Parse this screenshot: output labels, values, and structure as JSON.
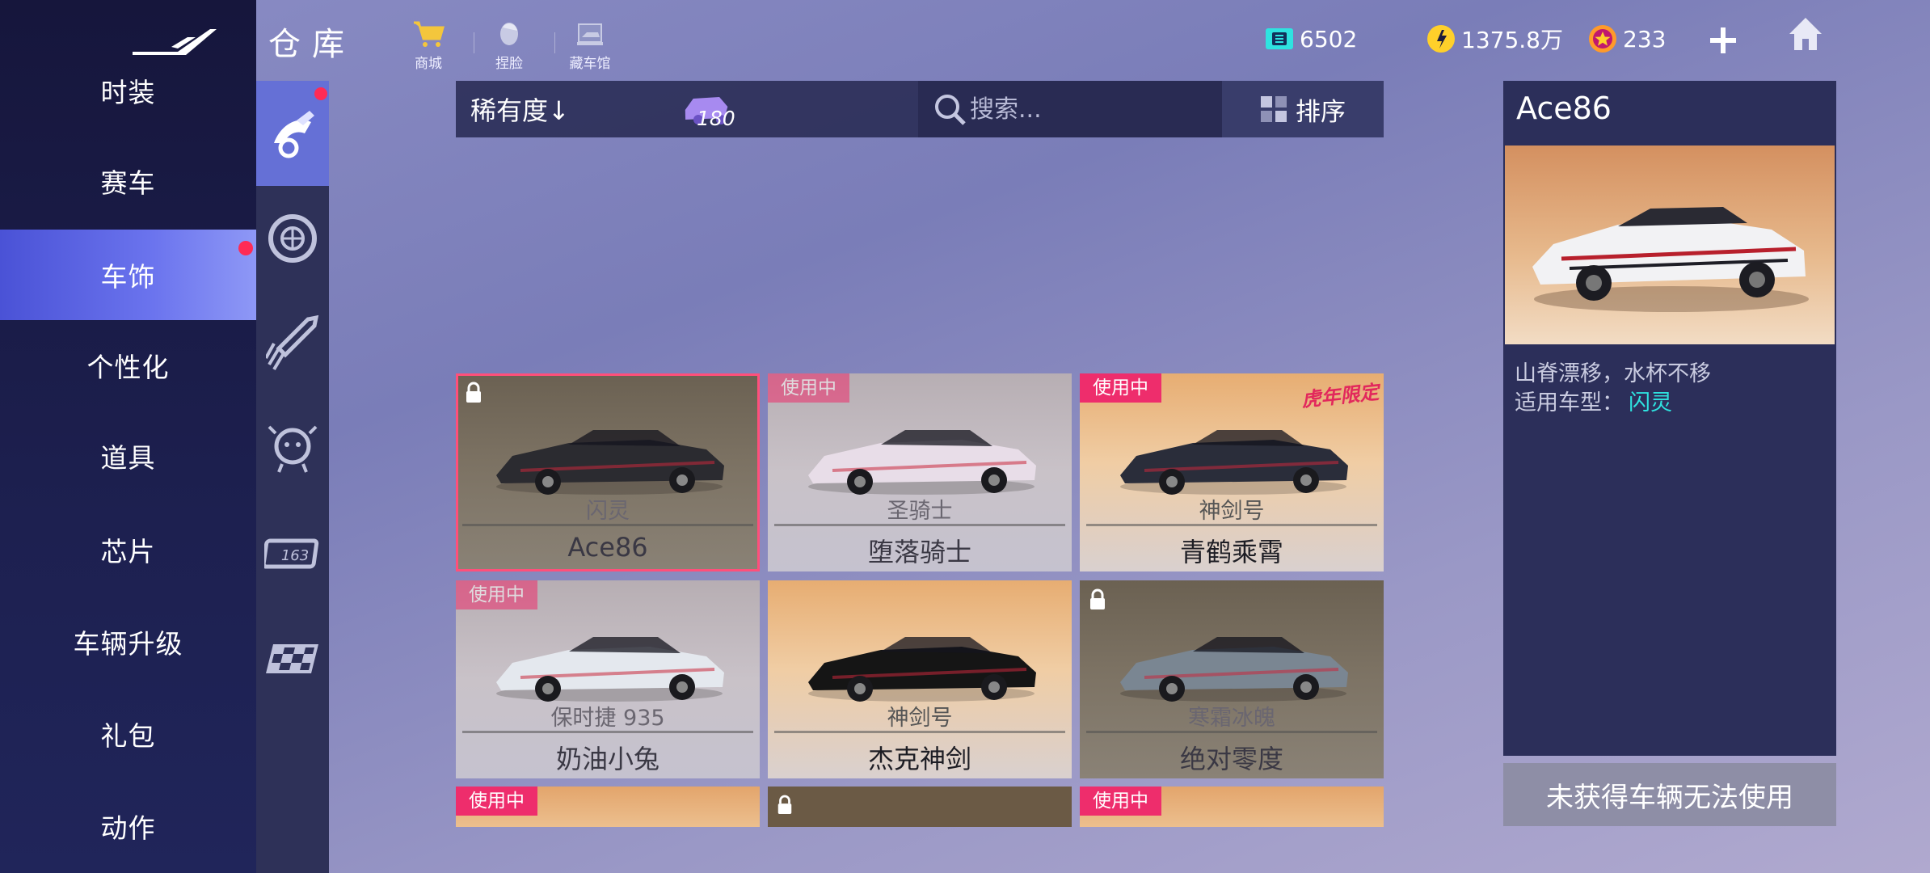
{
  "header": {
    "title": "仓库",
    "links": [
      {
        "label": "商城",
        "icon": "shop-cart-icon"
      },
      {
        "label": "捏脸",
        "icon": "face-edit-icon"
      },
      {
        "label": "藏车馆",
        "icon": "car-museum-icon"
      }
    ],
    "currencies": [
      {
        "value": "6502",
        "icon": "ticket-icon",
        "color": "#2ee3e0"
      },
      {
        "value": "1375.8万",
        "icon": "coin-icon",
        "color": "#ffd02a"
      },
      {
        "value": "233",
        "icon": "star-gem-icon",
        "color": "#ff9a2a"
      }
    ],
    "add_icon": "plus-icon",
    "home_icon": "home-icon"
  },
  "sidebar": {
    "items": [
      {
        "label": "时装"
      },
      {
        "label": "赛车"
      },
      {
        "label": "车饰",
        "active": true
      },
      {
        "label": "个性化"
      },
      {
        "label": "道具"
      },
      {
        "label": "芯片"
      },
      {
        "label": "车辆升级"
      },
      {
        "label": "礼包"
      },
      {
        "label": "动作"
      }
    ]
  },
  "categories": [
    "car-skin-icon",
    "wheel-icon",
    "rocket-icon",
    "pet-icon",
    "license-plate-icon",
    "flag-icon"
  ],
  "filter": {
    "sort_rarity_label": "稀有度↓",
    "owned_count": "180",
    "search_placeholder": "搜索...",
    "sort_label": "排序"
  },
  "cards": [
    {
      "model": "闪灵",
      "name": "Ace86",
      "state": "locked",
      "selected": true,
      "badge": ""
    },
    {
      "model": "圣骑士",
      "name": "堕落骑士",
      "state": "dim",
      "selected": false,
      "badge": "使用中"
    },
    {
      "model": "神剑号",
      "name": "青鹤乘霄",
      "state": "normal",
      "selected": false,
      "badge": "使用中",
      "stamp": "虎年限定"
    },
    {
      "model": "保时捷 935",
      "name": "奶油小兔",
      "state": "dim",
      "selected": false,
      "badge": "使用中"
    },
    {
      "model": "神剑号",
      "name": "杰克神剑",
      "state": "normal",
      "selected": false,
      "badge": ""
    },
    {
      "model": "寒霜冰魄",
      "name": "绝对零度",
      "state": "locked",
      "selected": false,
      "badge": ""
    }
  ],
  "partial_cards": [
    {
      "badge": "使用中"
    },
    {
      "badge": ""
    },
    {
      "badge": "使用中"
    }
  ],
  "detail": {
    "title": "Ace86",
    "description": "山脊漂移，水杯不移",
    "fit_label": "适用车型：",
    "fit_value": "闪灵",
    "unavailable_label": "未获得车辆无法使用"
  }
}
